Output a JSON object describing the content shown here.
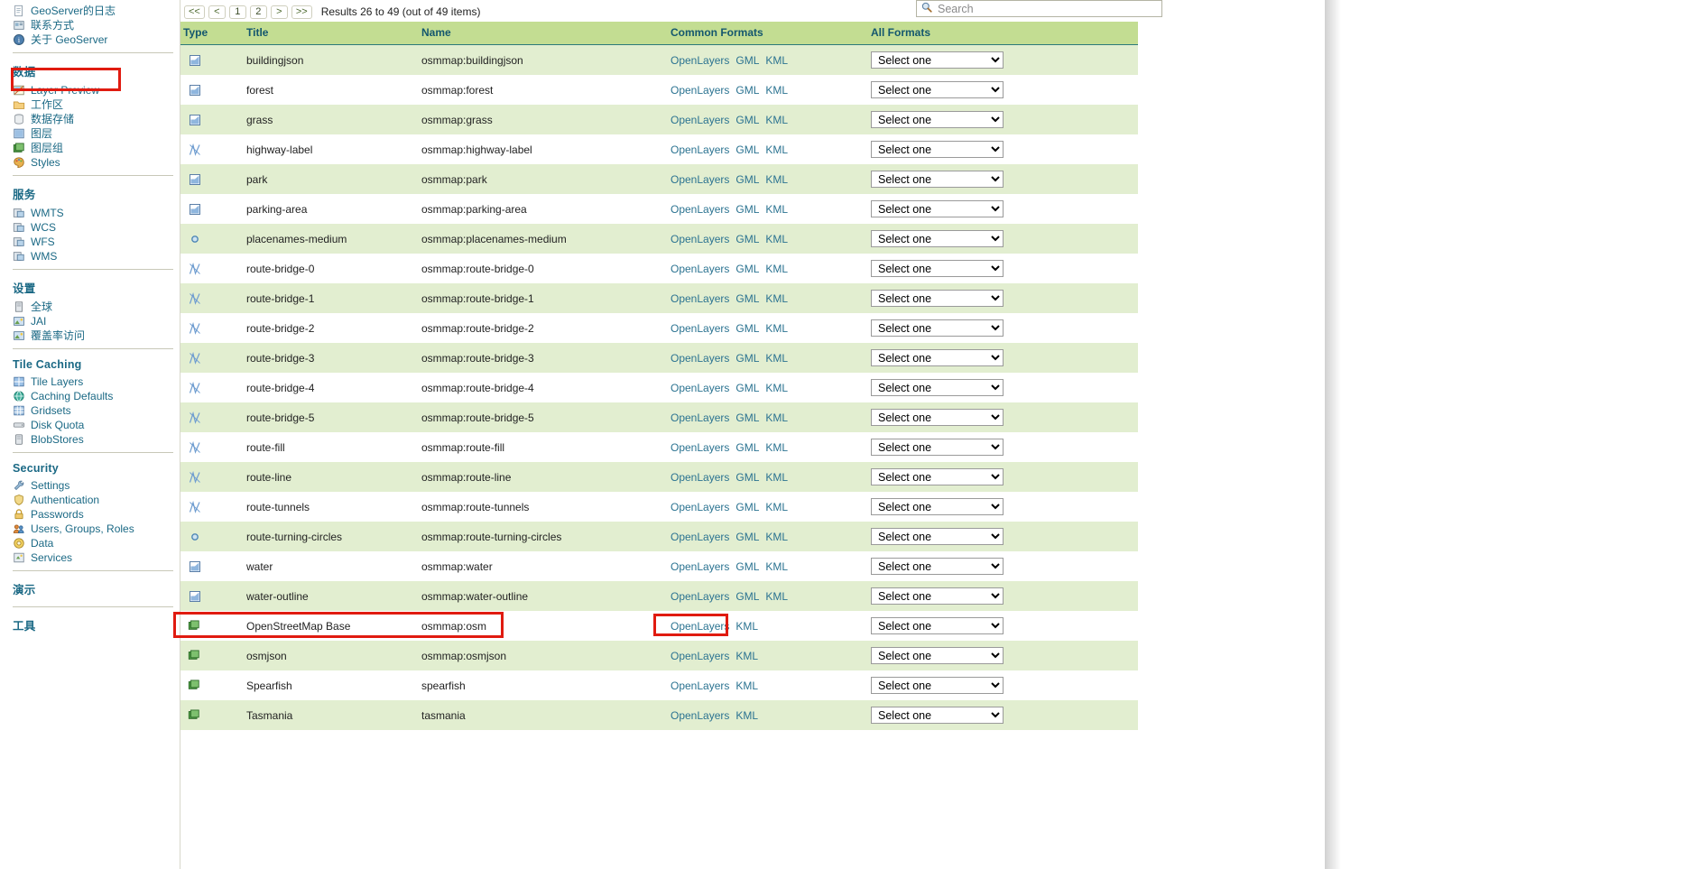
{
  "sidebar": {
    "top_items": [
      {
        "label": "GeoServer的日志",
        "icon": "document-icon"
      },
      {
        "label": "联系方式",
        "icon": "contact-icon"
      },
      {
        "label": "关于 GeoServer",
        "icon": "about-icon"
      }
    ],
    "sections": [
      {
        "heading": "数据",
        "items": [
          {
            "label": "Layer Preview",
            "icon": "layer-preview-icon",
            "highlighted": true
          },
          {
            "label": "工作区",
            "icon": "folder-icon"
          },
          {
            "label": "数据存储",
            "icon": "datastore-icon"
          },
          {
            "label": "图层",
            "icon": "layer-icon"
          },
          {
            "label": "图层组",
            "icon": "layergroup-icon"
          },
          {
            "label": "Styles",
            "icon": "palette-icon"
          }
        ]
      },
      {
        "heading": "服务",
        "items": [
          {
            "label": "WMTS",
            "icon": "service-icon"
          },
          {
            "label": "WCS",
            "icon": "service-icon"
          },
          {
            "label": "WFS",
            "icon": "service-icon"
          },
          {
            "label": "WMS",
            "icon": "service-icon"
          }
        ]
      },
      {
        "heading": "设置",
        "items": [
          {
            "label": "全球",
            "icon": "global-icon"
          },
          {
            "label": "JAI",
            "icon": "jai-icon"
          },
          {
            "label": "覆盖率访问",
            "icon": "coverage-icon"
          }
        ]
      },
      {
        "heading": "Tile Caching",
        "items": [
          {
            "label": "Tile Layers",
            "icon": "tile-layers-icon"
          },
          {
            "label": "Caching Defaults",
            "icon": "caching-defaults-icon"
          },
          {
            "label": "Gridsets",
            "icon": "gridsets-icon"
          },
          {
            "label": "Disk Quota",
            "icon": "disk-quota-icon"
          },
          {
            "label": "BlobStores",
            "icon": "blobstores-icon"
          }
        ]
      },
      {
        "heading": "Security",
        "items": [
          {
            "label": "Settings",
            "icon": "wrench-icon"
          },
          {
            "label": "Authentication",
            "icon": "shield-icon"
          },
          {
            "label": "Passwords",
            "icon": "lock-icon"
          },
          {
            "label": "Users, Groups, Roles",
            "icon": "users-icon"
          },
          {
            "label": "Data",
            "icon": "data-icon"
          },
          {
            "label": "Services",
            "icon": "services-icon"
          }
        ]
      },
      {
        "heading": "演示",
        "items": []
      },
      {
        "heading": "工具",
        "items": []
      }
    ]
  },
  "toolbar": {
    "first_label": "<<",
    "prev_label": "<",
    "page1_label": "1",
    "page2_label": "2",
    "next_label": ">",
    "last_label": ">>",
    "results_text": "Results 26 to 49 (out of 49 items)"
  },
  "search": {
    "placeholder": "Search",
    "value": "",
    "icon": "search-icon"
  },
  "table": {
    "columns": {
      "type": "Type",
      "title": "Title",
      "name": "Name",
      "common_formats": "Common Formats",
      "all_formats": "All Formats"
    },
    "select_placeholder": "Select one",
    "rows": [
      {
        "type_icon": "polygon-icon",
        "title": "buildingjson",
        "name": "osmmap:buildingjson",
        "formats": [
          "OpenLayers",
          "GML",
          "KML"
        ]
      },
      {
        "type_icon": "polygon-icon",
        "title": "forest",
        "name": "osmmap:forest",
        "formats": [
          "OpenLayers",
          "GML",
          "KML"
        ]
      },
      {
        "type_icon": "polygon-icon",
        "title": "grass",
        "name": "osmmap:grass",
        "formats": [
          "OpenLayers",
          "GML",
          "KML"
        ]
      },
      {
        "type_icon": "line-icon",
        "title": "highway-label",
        "name": "osmmap:highway-label",
        "formats": [
          "OpenLayers",
          "GML",
          "KML"
        ]
      },
      {
        "type_icon": "polygon-icon",
        "title": "park",
        "name": "osmmap:park",
        "formats": [
          "OpenLayers",
          "GML",
          "KML"
        ]
      },
      {
        "type_icon": "polygon-icon",
        "title": "parking-area",
        "name": "osmmap:parking-area",
        "formats": [
          "OpenLayers",
          "GML",
          "KML"
        ]
      },
      {
        "type_icon": "point-icon",
        "title": "placenames-medium",
        "name": "osmmap:placenames-medium",
        "formats": [
          "OpenLayers",
          "GML",
          "KML"
        ]
      },
      {
        "type_icon": "line-icon",
        "title": "route-bridge-0",
        "name": "osmmap:route-bridge-0",
        "formats": [
          "OpenLayers",
          "GML",
          "KML"
        ]
      },
      {
        "type_icon": "line-icon",
        "title": "route-bridge-1",
        "name": "osmmap:route-bridge-1",
        "formats": [
          "OpenLayers",
          "GML",
          "KML"
        ]
      },
      {
        "type_icon": "line-icon",
        "title": "route-bridge-2",
        "name": "osmmap:route-bridge-2",
        "formats": [
          "OpenLayers",
          "GML",
          "KML"
        ]
      },
      {
        "type_icon": "line-icon",
        "title": "route-bridge-3",
        "name": "osmmap:route-bridge-3",
        "formats": [
          "OpenLayers",
          "GML",
          "KML"
        ]
      },
      {
        "type_icon": "line-icon",
        "title": "route-bridge-4",
        "name": "osmmap:route-bridge-4",
        "formats": [
          "OpenLayers",
          "GML",
          "KML"
        ]
      },
      {
        "type_icon": "line-icon",
        "title": "route-bridge-5",
        "name": "osmmap:route-bridge-5",
        "formats": [
          "OpenLayers",
          "GML",
          "KML"
        ]
      },
      {
        "type_icon": "line-icon",
        "title": "route-fill",
        "name": "osmmap:route-fill",
        "formats": [
          "OpenLayers",
          "GML",
          "KML"
        ]
      },
      {
        "type_icon": "line-icon",
        "title": "route-line",
        "name": "osmmap:route-line",
        "formats": [
          "OpenLayers",
          "GML",
          "KML"
        ]
      },
      {
        "type_icon": "line-icon",
        "title": "route-tunnels",
        "name": "osmmap:route-tunnels",
        "formats": [
          "OpenLayers",
          "GML",
          "KML"
        ]
      },
      {
        "type_icon": "point-icon",
        "title": "route-turning-circles",
        "name": "osmmap:route-turning-circles",
        "formats": [
          "OpenLayers",
          "GML",
          "KML"
        ]
      },
      {
        "type_icon": "polygon-icon",
        "title": "water",
        "name": "osmmap:water",
        "formats": [
          "OpenLayers",
          "GML",
          "KML"
        ]
      },
      {
        "type_icon": "polygon-icon",
        "title": "water-outline",
        "name": "osmmap:water-outline",
        "formats": [
          "OpenLayers",
          "GML",
          "KML"
        ]
      },
      {
        "type_icon": "layergroup-icon",
        "title": "OpenStreetMap Base",
        "name": "osmmap:osm",
        "formats": [
          "OpenLayers",
          "KML"
        ]
      },
      {
        "type_icon": "layergroup-icon",
        "title": "osmjson",
        "name": "osmmap:osmjson",
        "formats": [
          "OpenLayers",
          "KML"
        ]
      },
      {
        "type_icon": "layergroup-icon",
        "title": "Spearfish",
        "name": "spearfish",
        "formats": [
          "OpenLayers",
          "KML"
        ]
      },
      {
        "type_icon": "layergroup-icon",
        "title": "Tasmania",
        "name": "tasmania",
        "formats": [
          "OpenLayers",
          "KML"
        ]
      }
    ]
  },
  "colors": {
    "header_green": "#c3dd92",
    "row_green": "#e2eed0",
    "link_blue": "#2b7391",
    "heading_blue": "#1b6985",
    "highlight_red": "#e01b10"
  }
}
